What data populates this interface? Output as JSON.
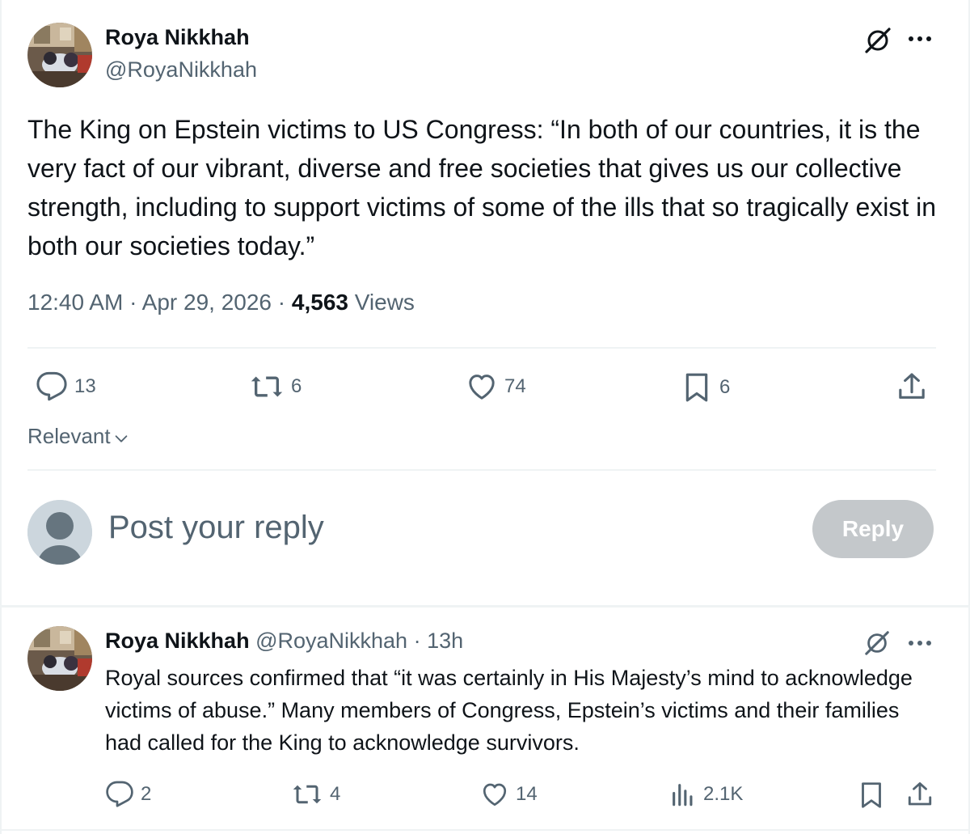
{
  "main_tweet": {
    "author_name": "Roya Nikkhah",
    "author_handle": "@RoyaNikkhah",
    "text": "The King on Epstein victims to US Congress: “In both of our countries, it is the very fact of our vibrant, diverse and free societies that gives us our collective strength, including to support victims of some of the ills that so tragically exist in both our societies today.”",
    "time": "12:40 AM",
    "date": "Apr 29, 2026",
    "views_count": "4,563",
    "views_label": "Views",
    "separator": "·",
    "stats": {
      "replies": "13",
      "reposts": "6",
      "likes": "74",
      "bookmarks": "6"
    }
  },
  "sort": {
    "label": "Relevant"
  },
  "reply_box": {
    "placeholder": "Post your reply",
    "button_label": "Reply"
  },
  "reply_tweet": {
    "author_name": "Roya Nikkhah",
    "author_handle": "@RoyaNikkhah",
    "separator": "·",
    "age": "13h",
    "text": "Royal sources confirmed that “it was certainly in His Majesty’s mind to acknowledge victims of abuse.” Many members of Congress, Epstein’s victims and their families had called for the King to acknowledge survivors.",
    "stats": {
      "replies": "2",
      "reposts": "4",
      "likes": "14",
      "views": "2.1K"
    }
  },
  "icons": {
    "grok": "grok-icon",
    "more": "more-icon",
    "reply": "reply-icon",
    "repost": "repost-icon",
    "like": "heart-icon",
    "bookmark": "bookmark-icon",
    "share": "share-icon",
    "views": "views-icon",
    "chevron": "chevron-down-icon"
  },
  "colors": {
    "text": "#0f1419",
    "muted": "#536471",
    "divider": "#eff3f4",
    "reply_button_disabled": "#c4c8cb"
  }
}
